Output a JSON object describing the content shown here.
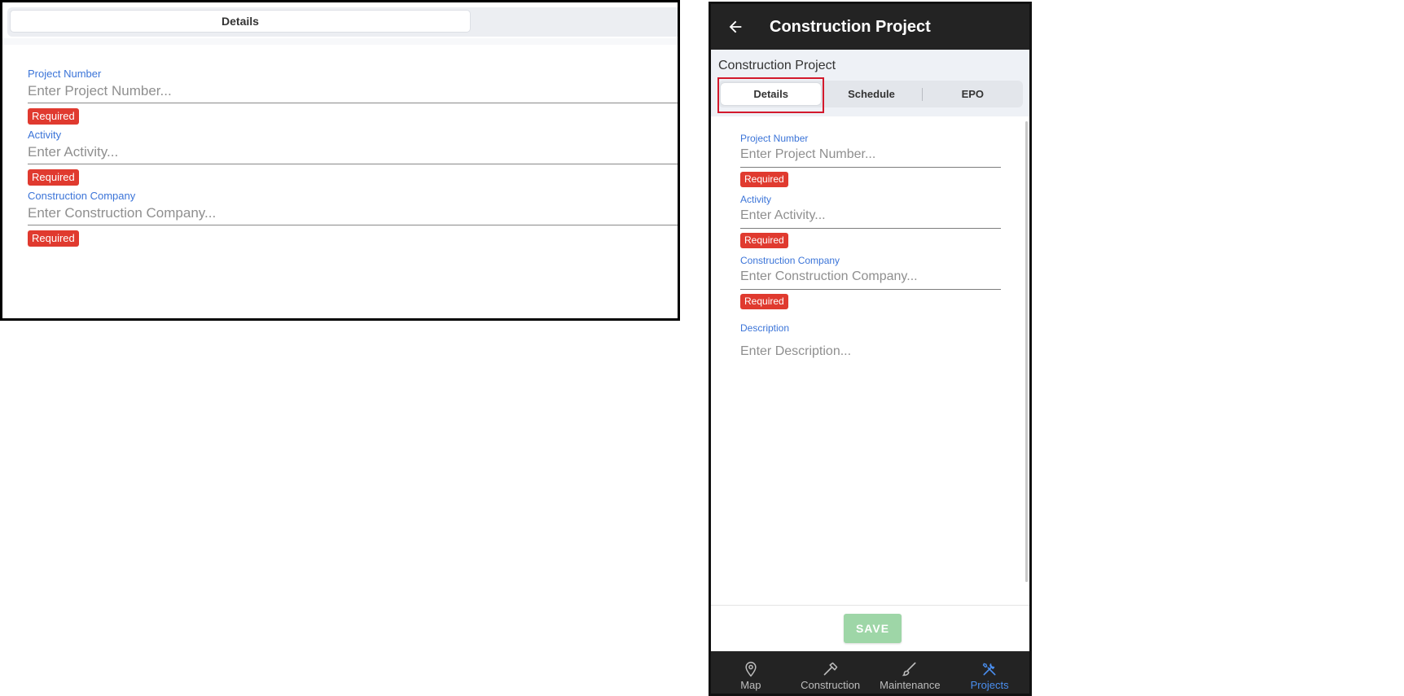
{
  "zoom": {
    "tab_label": "Details",
    "fields": [
      {
        "label": "Project Number",
        "placeholder": "Enter Project Number...",
        "badge": "Required"
      },
      {
        "label": "Activity",
        "placeholder": "Enter Activity...",
        "badge": "Required"
      },
      {
        "label": "Construction Company",
        "placeholder": "Enter Construction Company...",
        "badge": "Required"
      }
    ]
  },
  "phone": {
    "appbar": {
      "title": "Construction Project",
      "back_icon": "arrow-left-icon"
    },
    "subtitle": "Construction Project",
    "tabs": [
      {
        "label": "Details",
        "active": true
      },
      {
        "label": "Schedule",
        "active": false
      },
      {
        "label": "EPO",
        "active": false
      }
    ],
    "fields": [
      {
        "label": "Project Number",
        "placeholder": "Enter Project Number...",
        "badge": "Required"
      },
      {
        "label": "Activity",
        "placeholder": "Enter Activity...",
        "badge": "Required"
      },
      {
        "label": "Construction Company",
        "placeholder": "Enter Construction Company...",
        "badge": "Required"
      },
      {
        "label": "Description",
        "placeholder": "Enter Description..."
      }
    ],
    "save_label": "SAVE",
    "nav": [
      {
        "label": "Map",
        "icon": "map-pin-icon",
        "active": false
      },
      {
        "label": "Construction",
        "icon": "hammer-icon",
        "active": false
      },
      {
        "label": "Maintenance",
        "icon": "brush-icon",
        "active": false
      },
      {
        "label": "Projects",
        "icon": "tools-icon",
        "active": true
      }
    ]
  },
  "colors": {
    "accent_blue": "#3b74d8",
    "required_red": "#e03a2f",
    "appbar_dark": "#232323",
    "save_green": "#9ed6a7",
    "highlight_red": "#d3192c",
    "nav_active": "#4a8ff0"
  }
}
